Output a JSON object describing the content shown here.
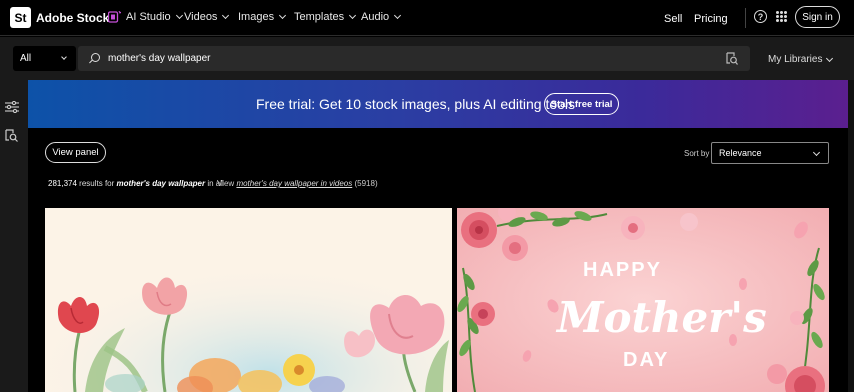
{
  "topnav": {
    "logo_text": "St",
    "brand": "Adobe Stock",
    "items": [
      {
        "label": "AI Studio",
        "icon": "ai-studio-icon"
      },
      {
        "label": "Videos"
      },
      {
        "label": "Images"
      },
      {
        "label": "Templates"
      },
      {
        "label": "Audio"
      }
    ],
    "sell": "Sell",
    "pricing": "Pricing",
    "help_icon_glyph": "?",
    "signin": "Sign in"
  },
  "search": {
    "scope": "All",
    "query": "mother's day wallpaper",
    "my_libraries": "My Libraries"
  },
  "banner": {
    "text": "Free trial: Get 10 stock images, plus AI editing tools",
    "button": "Start free trial"
  },
  "results": {
    "view_panel": "View panel",
    "sort_by_label": "Sort by",
    "sort_value": "Relevance",
    "count": "281,374",
    "results_for": "results for",
    "query": "mother's day wallpaper",
    "in_all": "in all",
    "view_prefix": "View",
    "videos_link": "mother's day wallpaper in videos",
    "videos_count": "(5918)"
  },
  "cards": [
    {
      "image": "watercolor-tulips-image"
    },
    {
      "image": "happy-mothers-day-roses-image",
      "lettering": [
        "HAPPY",
        "Mother's",
        "DAY"
      ]
    }
  ],
  "colors": {
    "banner_start": "#0d52a8",
    "banner_end": "#5b1f8f",
    "ai_accent": "#c64fd8"
  }
}
